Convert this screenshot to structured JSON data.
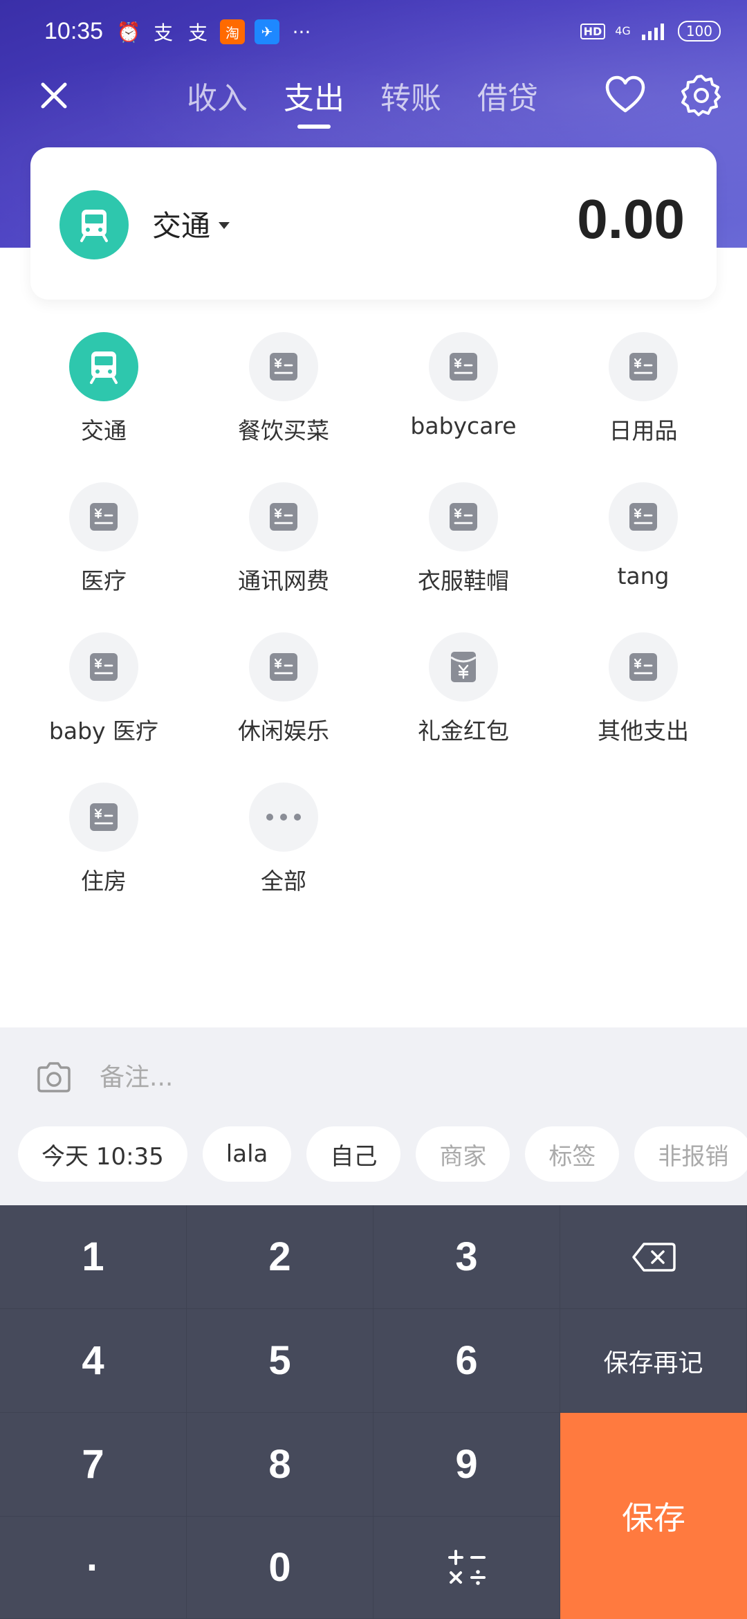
{
  "status_bar": {
    "time": "10:35",
    "hd": "HD",
    "network": "4G",
    "battery": "100"
  },
  "nav": {
    "tabs": [
      {
        "label": "收入",
        "active": false
      },
      {
        "label": "支出",
        "active": true
      },
      {
        "label": "转账",
        "active": false
      },
      {
        "label": "借贷",
        "active": false
      }
    ]
  },
  "amount_card": {
    "category": "交通",
    "amount": "0.00"
  },
  "categories": [
    {
      "label": "交通",
      "icon": "bus-icon",
      "selected": true
    },
    {
      "label": "餐饮买菜",
      "icon": "ledger-icon"
    },
    {
      "label": "babycare",
      "icon": "ledger-icon"
    },
    {
      "label": "日用品",
      "icon": "ledger-icon"
    },
    {
      "label": "医疗",
      "icon": "ledger-icon"
    },
    {
      "label": "通讯网费",
      "icon": "ledger-icon"
    },
    {
      "label": "衣服鞋帽",
      "icon": "ledger-icon"
    },
    {
      "label": "tang",
      "icon": "ledger-icon"
    },
    {
      "label": "baby 医疗",
      "icon": "ledger-icon"
    },
    {
      "label": "休闲娱乐",
      "icon": "ledger-icon"
    },
    {
      "label": "礼金红包",
      "icon": "red-packet-icon"
    },
    {
      "label": "其他支出",
      "icon": "ledger-icon"
    },
    {
      "label": "住房",
      "icon": "ledger-icon"
    },
    {
      "label": "全部",
      "icon": "more-icon"
    }
  ],
  "note": {
    "placeholder": "备注..."
  },
  "chips": [
    {
      "label": "今天 10:35",
      "muted": false
    },
    {
      "label": "lala",
      "muted": false
    },
    {
      "label": "自己",
      "muted": false
    },
    {
      "label": "商家",
      "muted": true
    },
    {
      "label": "标签",
      "muted": true
    },
    {
      "label": "非报销",
      "muted": true
    }
  ],
  "keypad": {
    "k1": "1",
    "k2": "2",
    "k3": "3",
    "k4": "4",
    "k5": "5",
    "k6": "6",
    "k7": "7",
    "k8": "8",
    "k9": "9",
    "dot": "·",
    "k0": "0",
    "ops": "+−\n×÷",
    "save_again": "保存再记",
    "save": "保存"
  },
  "colors": {
    "accent_green": "#2ec7ad",
    "save_orange": "#ff7a3f",
    "keypad_bg": "#464a5b",
    "header_purple": "#4a3fc0"
  }
}
